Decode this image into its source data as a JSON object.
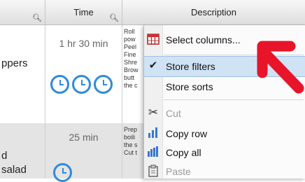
{
  "header": {
    "time_label": "Time",
    "description_label": "Description"
  },
  "rows": [
    {
      "name": "ppers",
      "time": "1 hr 30 min",
      "desc_lines": [
        "Roll",
        "pow",
        "Peel",
        "Fine",
        "Shre",
        "Brow",
        "butt",
        "the c"
      ]
    },
    {
      "name_line1": "d",
      "name_line2": "salad",
      "time": "25 min",
      "desc_lines": [
        "Prep",
        "boili",
        "the s",
        "Cut t"
      ]
    }
  ],
  "menu": {
    "select_columns": "Select columns...",
    "store_filters": "Store filters",
    "store_sorts": "Store sorts",
    "cut": "Cut",
    "copy_row": "Copy row",
    "copy_all": "Copy all",
    "paste": "Paste"
  },
  "colors": {
    "clock_blue": "#2e8bdc",
    "arrow_red": "#e8142a",
    "highlight": "#cfe3f5"
  }
}
